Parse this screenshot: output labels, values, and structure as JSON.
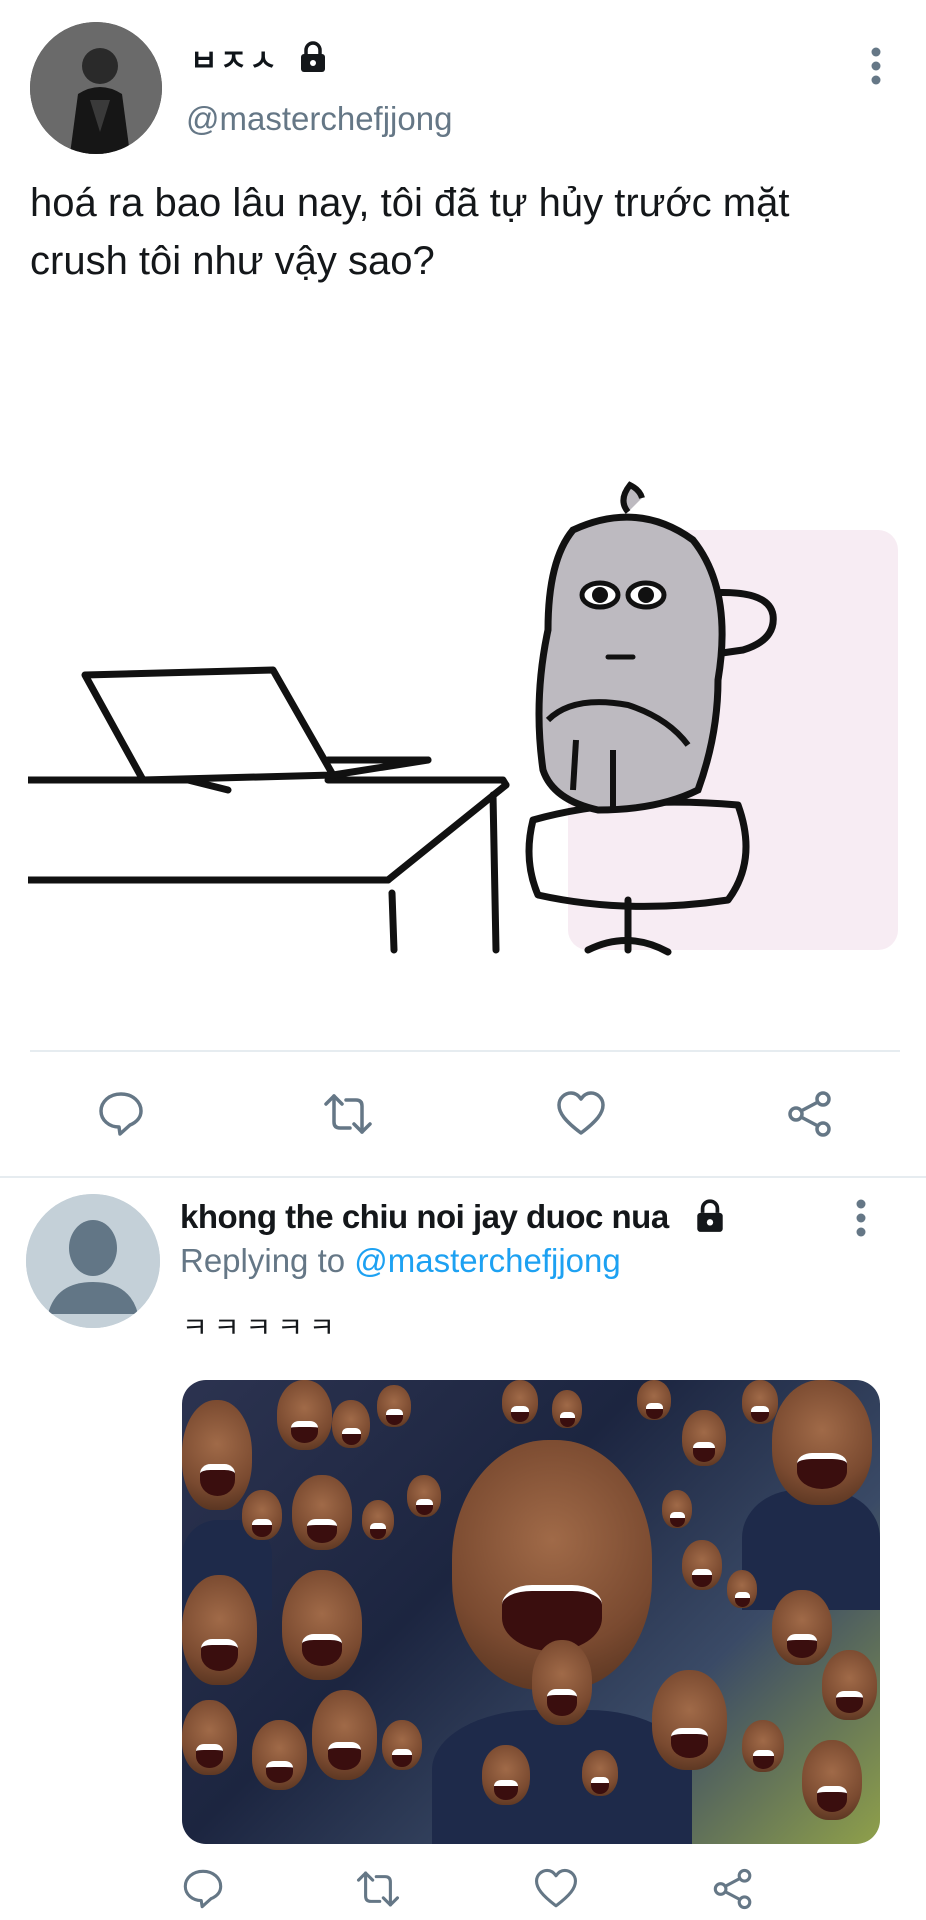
{
  "tweet1": {
    "display_name": "ㅂㅈㅅ",
    "handle": "@masterchefjjong",
    "text": "hoá ra bao lâu nay, tôi đã tự hủy trước mặt crush tôi như vậy sao?",
    "icons": {
      "avatar": "profile-photo",
      "lock": "lock-icon",
      "more": "more-vertical-icon",
      "reply": "reply-icon",
      "retweet": "retweet-icon",
      "like": "heart-icon",
      "share": "share-icon"
    }
  },
  "tweet2": {
    "display_name": "khong the chiu noi jay duoc nua",
    "replying_prefix": "Replying to",
    "replying_handle": "@masterchefjjong",
    "text": "ㅋㅋㅋㅋㅋ"
  },
  "colors": {
    "text": "#14171a",
    "secondary": "#657786",
    "link": "#1da1f2",
    "divider": "#e6ecf0",
    "icon": "#657786"
  }
}
